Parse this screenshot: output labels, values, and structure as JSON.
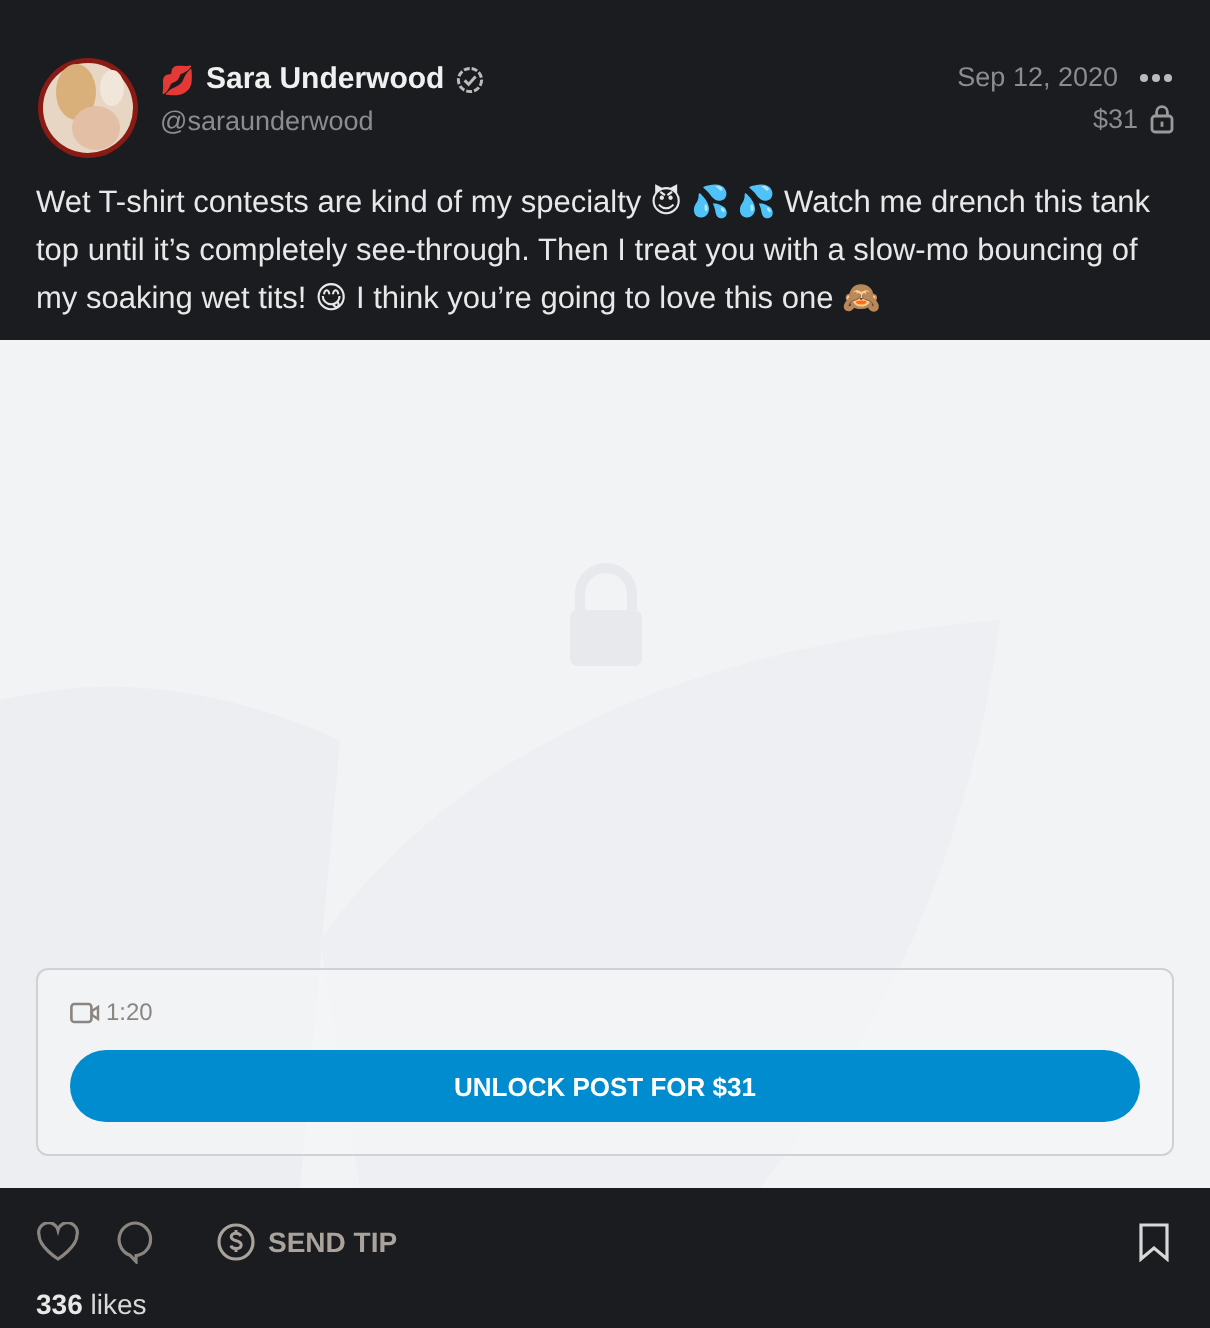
{
  "post": {
    "author": {
      "emoji": "💋",
      "name": "Sara Underwood",
      "verified": true,
      "handle": "@saraunderwood"
    },
    "date": "Sep 12, 2020",
    "price": "$31",
    "locked": true,
    "text": "Wet T-shirt contests are kind of my specialty 😈 💦 💦 Watch me drench this tank top until it’s completely see-through. Then I treat you with a slow-mo bouncing of my soaking wet tits! 😋 I think you’re going to love this one 🙈",
    "media": {
      "duration": "1:20",
      "unlock_label": "UNLOCK POST FOR $31"
    },
    "actions": {
      "liked": false,
      "bookmarked": false,
      "tip_label": "SEND TIP"
    },
    "likes": {
      "count": "336",
      "label": "likes"
    }
  }
}
